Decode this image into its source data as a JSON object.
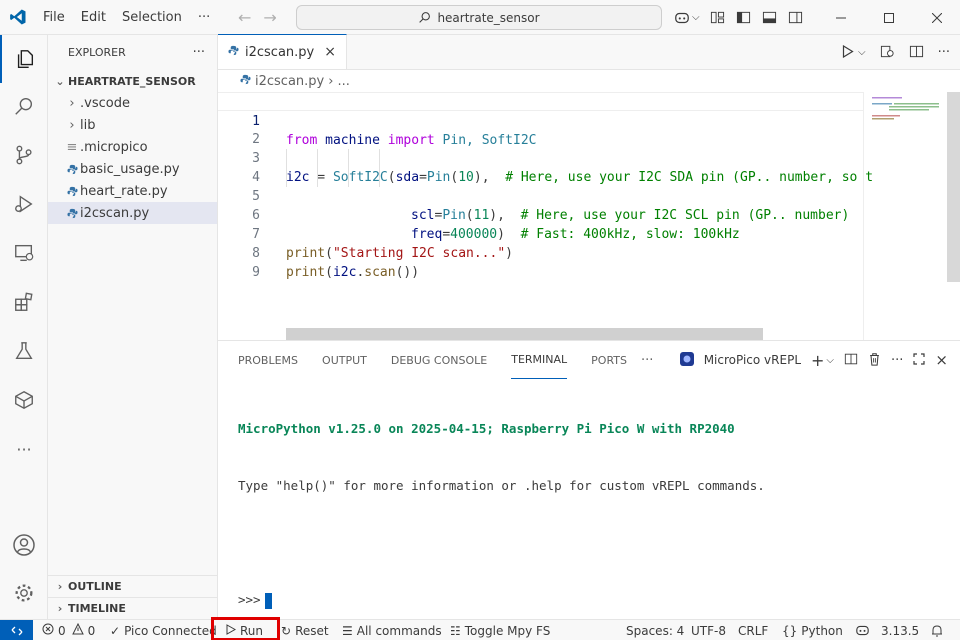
{
  "titlebar": {
    "menu": [
      "File",
      "Edit",
      "Selection",
      "···"
    ],
    "search_text": "heartrate_sensor"
  },
  "sidebar": {
    "header": "EXPLORER",
    "more": "···",
    "folder": "HEARTRATE_SENSOR",
    "items": [
      {
        "label": ".vscode",
        "type": "folder"
      },
      {
        "label": "lib",
        "type": "folder"
      },
      {
        "label": ".micropico",
        "type": "file-lines"
      },
      {
        "label": "basic_usage.py",
        "type": "python"
      },
      {
        "label": "heart_rate.py",
        "type": "python"
      },
      {
        "label": "i2cscan.py",
        "type": "python",
        "selected": true
      }
    ],
    "outline": "OUTLINE",
    "timeline": "TIMELINE"
  },
  "editor": {
    "tab_label": "i2cscan.py",
    "breadcrumb_file": "i2cscan.py",
    "breadcrumb_more": "...",
    "line_numbers": [
      "1",
      "2",
      "3",
      "4",
      "5",
      "6",
      "7",
      "8",
      "9"
    ]
  },
  "code": {
    "l1": {
      "kw1": "from",
      "mod": " machine ",
      "kw2": "import",
      "names": " Pin, SoftI2C"
    },
    "l3": {
      "var": "i2c",
      "eq": " = ",
      "cls": "SoftI2C",
      "p1": "(",
      "arg": "sda",
      "eq2": "=",
      "cls2": "Pin",
      "p2": "(",
      "num": "10",
      "p3": "),  ",
      "cmt": "# Here, use your I2C SDA pin (GP.. number, so t"
    },
    "l4": {
      "arg": "scl",
      "eq": "=",
      "cls": "Pin",
      "p1": "(",
      "num": "11",
      "p2": "),  ",
      "cmt": "# Here, use your I2C SCL pin (GP.. number)"
    },
    "l5": {
      "arg": "freq",
      "eq": "=",
      "num": "400000",
      "p1": ")  ",
      "cmt": "# Fast: 400kHz, slow: 100kHz"
    },
    "l7": {
      "fn": "print",
      "p1": "(",
      "str": "\"Starting I2C scan...\"",
      "p2": ")"
    },
    "l8": {
      "fn": "print",
      "p1": "(",
      "var": "i2c",
      "dot": ".",
      "fn2": "scan",
      "p2": "())"
    }
  },
  "panel": {
    "tabs": [
      "PROBLEMS",
      "OUTPUT",
      "DEBUG CONSOLE",
      "TERMINAL",
      "PORTS"
    ],
    "active_tab": "TERMINAL",
    "more": "···",
    "terminal_name": "MicroPico vREPL",
    "banner": "MicroPython v1.25.0 on 2025-04-15; Raspberry Pi Pico W with RP2040",
    "help_line": "Type \"help()\" for more information or .help for custom vREPL commands.",
    "prompt": ">>>"
  },
  "statusbar": {
    "errors": "0",
    "warnings": "0",
    "pico": "Pico Connected",
    "run": "Run",
    "reset": "Reset",
    "all_commands": "All commands",
    "toggle_fs": "Toggle Mpy FS",
    "spaces": "Spaces: 4",
    "encoding": "UTF-8",
    "eol": "CRLF",
    "language": "Python",
    "python_version": "3.13.5"
  },
  "colors": {
    "accent": "#005fb8",
    "highlight_box": "#e00000",
    "terminal_banner": "#098658"
  }
}
